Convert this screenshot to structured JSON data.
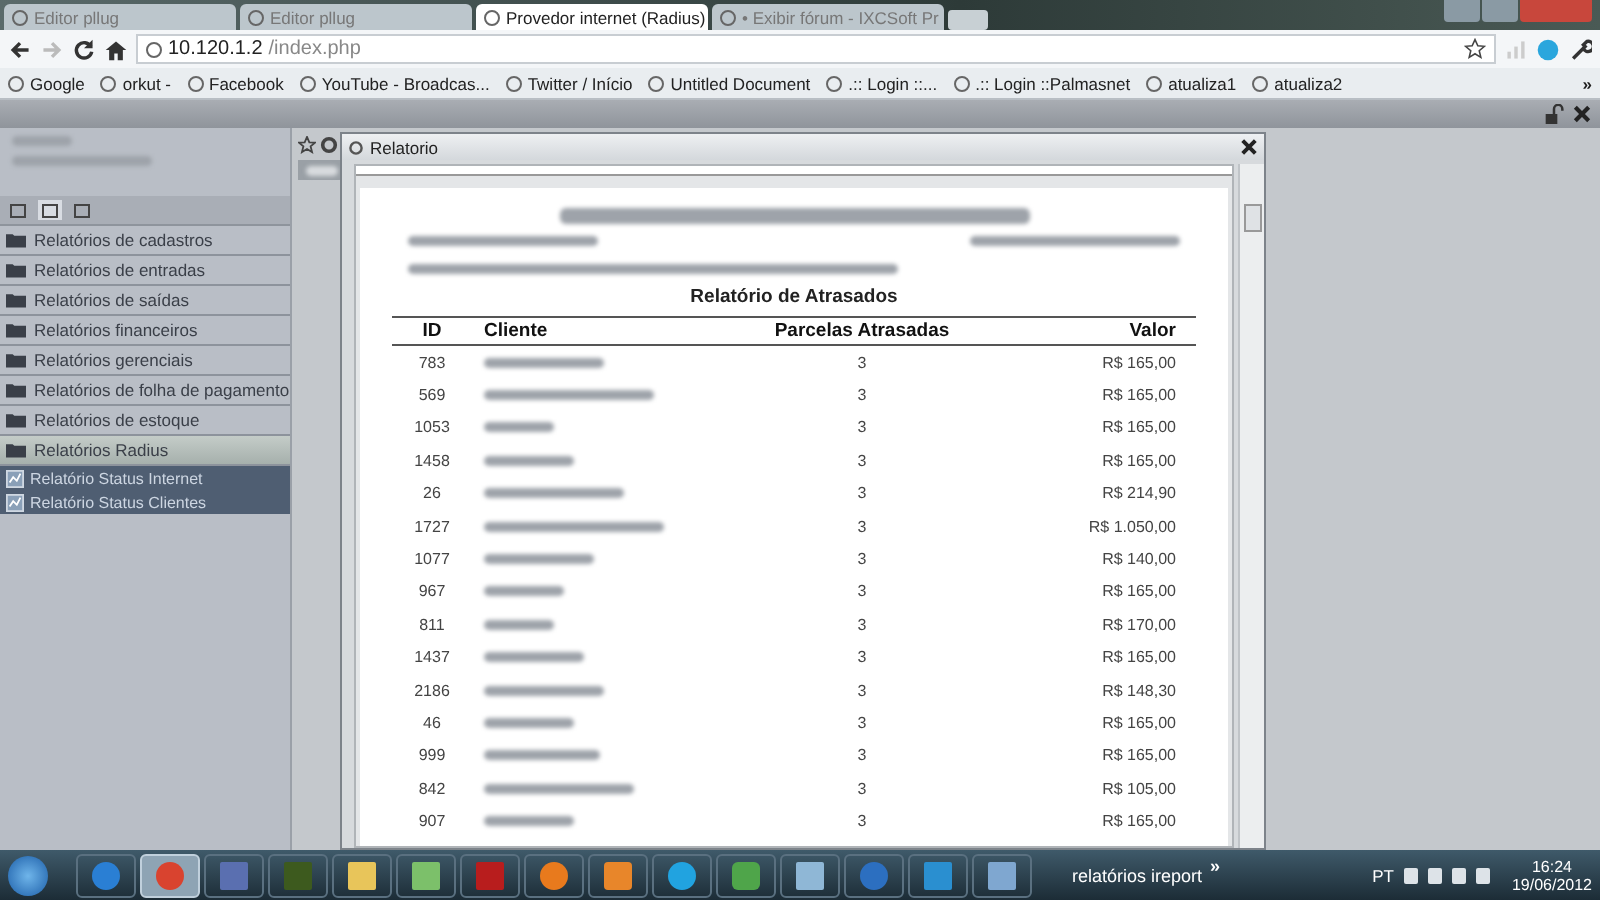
{
  "browser": {
    "tabs": [
      {
        "label": "Editor pllug",
        "selected": false
      },
      {
        "label": "Editor pllug",
        "selected": false
      },
      {
        "label": "Provedor internet (Radius)",
        "selected": true
      },
      {
        "label": "• Exibir fórum - IXCSoft Pr",
        "selected": false
      }
    ],
    "address": {
      "host": "10.120.1.2",
      "path": "/index.php"
    },
    "bookmarks": [
      {
        "label": "Google"
      },
      {
        "label": "orkut -"
      },
      {
        "label": "Facebook"
      },
      {
        "label": "YouTube - Broadcas..."
      },
      {
        "label": "Twitter / Início"
      },
      {
        "label": "Untitled Document"
      },
      {
        "label": ".:: Login ::..."
      },
      {
        "label": ".:: Login ::Palmasnet"
      },
      {
        "label": "atualiza1"
      },
      {
        "label": "atualiza2"
      }
    ],
    "bookmarks_more": "»"
  },
  "sidebar": {
    "tabs": [
      {
        "selected": false
      },
      {
        "selected": true
      },
      {
        "selected": false
      }
    ],
    "items": [
      {
        "label": "Relatórios de cadastros",
        "expanded": false
      },
      {
        "label": "Relatórios de entradas",
        "expanded": false
      },
      {
        "label": "Relatórios de saídas",
        "expanded": false
      },
      {
        "label": "Relatórios financeiros",
        "expanded": false
      },
      {
        "label": "Relatórios gerenciais",
        "expanded": false
      },
      {
        "label": "Relatórios de folha de pagamento",
        "expanded": false
      },
      {
        "label": "Relatórios de estoque",
        "expanded": false
      },
      {
        "label": "Relatórios Radius",
        "expanded": true,
        "children": [
          {
            "label": "Relatório Status Internet"
          },
          {
            "label": "Relatório Status Clientes"
          }
        ]
      }
    ]
  },
  "dialog": {
    "title": "Relatorio",
    "report": {
      "title": "Relatório de Atrasados",
      "columns": [
        "ID",
        "Cliente",
        "Parcelas Atrasadas",
        "Valor"
      ],
      "rows": [
        {
          "id": "783",
          "parcelas": "3",
          "valor": "R$ 165,00"
        },
        {
          "id": "569",
          "parcelas": "3",
          "valor": "R$ 165,00"
        },
        {
          "id": "1053",
          "parcelas": "3",
          "valor": "R$ 165,00"
        },
        {
          "id": "1458",
          "parcelas": "3",
          "valor": "R$ 165,00"
        },
        {
          "id": "26",
          "parcelas": "3",
          "valor": "R$ 214,90"
        },
        {
          "id": "1727",
          "parcelas": "3",
          "valor": "R$ 1.050,00"
        },
        {
          "id": "1077",
          "parcelas": "3",
          "valor": "R$ 140,00"
        },
        {
          "id": "967",
          "parcelas": "3",
          "valor": "R$ 165,00"
        },
        {
          "id": "811",
          "parcelas": "3",
          "valor": "R$ 170,00"
        },
        {
          "id": "1437",
          "parcelas": "3",
          "valor": "R$ 165,00"
        },
        {
          "id": "2186",
          "parcelas": "3",
          "valor": "R$ 148,30"
        },
        {
          "id": "46",
          "parcelas": "3",
          "valor": "R$ 165,00"
        },
        {
          "id": "999",
          "parcelas": "3",
          "valor": "R$ 165,00"
        },
        {
          "id": "842",
          "parcelas": "3",
          "valor": "R$ 105,00"
        },
        {
          "id": "907",
          "parcelas": "3",
          "valor": "R$ 165,00"
        }
      ]
    }
  },
  "taskbar": {
    "apps": [
      {
        "selected": false
      },
      {
        "selected": true
      },
      {
        "selected": false
      },
      {
        "selected": false
      },
      {
        "selected": false
      },
      {
        "selected": false
      },
      {
        "selected": false
      },
      {
        "selected": false
      },
      {
        "selected": false
      },
      {
        "selected": false
      },
      {
        "selected": false
      },
      {
        "selected": false
      },
      {
        "selected": false
      },
      {
        "selected": false
      },
      {
        "selected": false
      }
    ],
    "task": "relatórios ireport",
    "task_more": "»",
    "language": "PT",
    "time": "16:24",
    "date": "19/06/2012"
  }
}
